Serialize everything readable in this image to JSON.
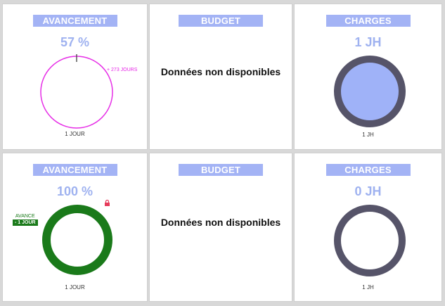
{
  "row1": {
    "avancement": {
      "header": "AVANCEMENT",
      "value": "57 %",
      "marker_label": "+ 273 JOURS",
      "footer": "1 JOUR",
      "ring_color": "#e62ee6"
    },
    "budget": {
      "header": "BUDGET",
      "message": "Données non disponibles"
    },
    "charges": {
      "header": "CHARGES",
      "value": "1 JH",
      "footer": "1 JH",
      "fill_color": "#9fb2f8",
      "ring_color": "#565469"
    }
  },
  "row2": {
    "avancement": {
      "header": "AVANCEMENT",
      "value": "100 %",
      "badge_label": "AVANCE",
      "badge_value": "- 1 JOUR",
      "footer": "1 JOUR",
      "ring_color": "#1a7a1a",
      "lock_color": "#e63a5a"
    },
    "budget": {
      "header": "BUDGET",
      "message": "Données non disponibles"
    },
    "charges": {
      "header": "CHARGES",
      "value": "0 JH",
      "footer": "1 JH",
      "ring_color": "#565469"
    }
  }
}
